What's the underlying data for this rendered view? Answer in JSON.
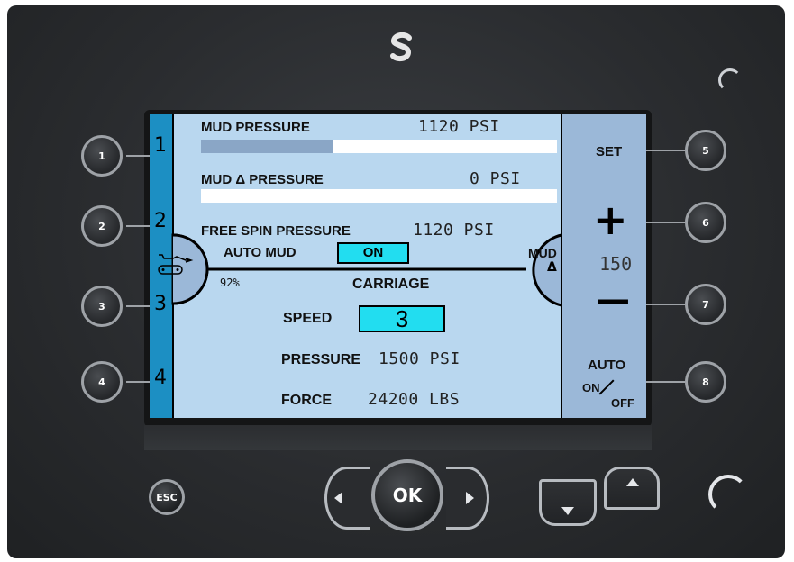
{
  "screen": {
    "rows": [
      {
        "label": "MUD PRESSURE",
        "value": "1120 PSI",
        "level_pct": 37
      },
      {
        "label": "MUD Δ PRESSURE",
        "value": "0 PSI",
        "level_pct": 0
      },
      {
        "label": "FREE SPIN PRESSURE",
        "value": "1120 PSI"
      }
    ],
    "auto_mud": {
      "label": "AUTO MUD",
      "value": "ON"
    },
    "percent": "92%",
    "carriage": {
      "title": "CARRIAGE",
      "speed_label": "SPEED",
      "speed_value": "3",
      "pressure_label": "PRESSURE",
      "pressure_value": "1500 PSI",
      "force_label": "FORCE",
      "force_value": "24200 LBS"
    },
    "left_numbers": [
      "1",
      "2",
      "3",
      "4"
    ],
    "right_panel": {
      "set_label": "SET",
      "plus": "+",
      "value": "150",
      "minus": "—",
      "mud_label": "MUD",
      "delta": "Δ",
      "auto_label": "AUTO",
      "on_label": "ON",
      "off_label": "OFF"
    }
  },
  "hardware": {
    "side_buttons": [
      "1",
      "2",
      "3",
      "4",
      "5",
      "6",
      "7",
      "8"
    ],
    "esc_label": "ESC",
    "ok_label": "OK"
  },
  "colors": {
    "screen_bg": "#b9d7ef",
    "accent_strip": "#1c8fc3",
    "highlight": "#22ddf0",
    "right_panel": "#9bb8d8"
  }
}
